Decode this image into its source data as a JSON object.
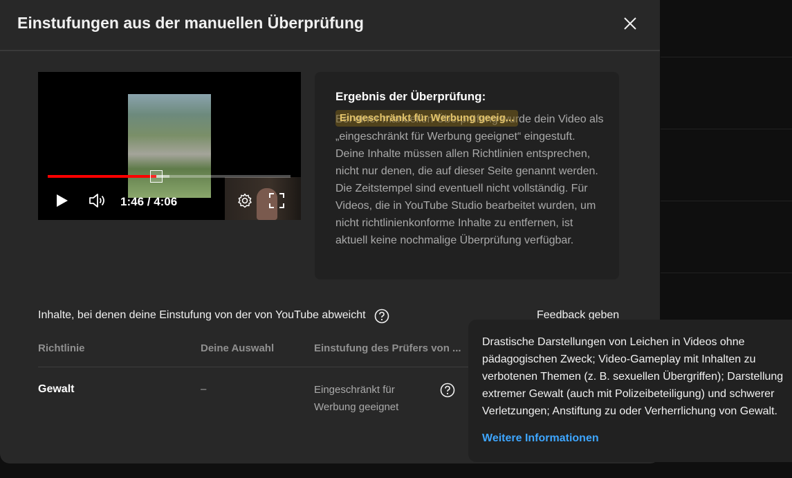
{
  "dialog": {
    "title": "Einstufungen aus der manuellen Überprüfung"
  },
  "player": {
    "time": "1:46 / 4:06",
    "progress": 0.446,
    "buffered": 0.5
  },
  "result": {
    "title": "Ergebnis der Überprüfung:",
    "badge": "Eingeschränkt für Werbung geeig...",
    "text": "Bei einer manuellen Überprüfung wurde dein Video als „eingeschränkt für Werbung geeignet“ eingestuft. Deine Inhalte müssen allen Richtlinien entsprechen, nicht nur denen, die auf dieser Seite genannt werden. Die Zeitstempel sind eventuell nicht vollständig. Für Videos, die in YouTube Studio bearbeitet wurden, um nicht richtlinienkonforme Inhalte zu entfernen, ist aktuell keine nochmalige Überprüfung verfügbar."
  },
  "section": {
    "label": "Inhalte, bei denen deine Einstufung von der von YouTube abweicht",
    "feedback": "Feedback geben"
  },
  "table": {
    "headers": [
      "Richtlinie",
      "Deine Auswahl",
      "Einstufung des Prüfers von ..."
    ],
    "rows": [
      {
        "policy": "Gewalt",
        "choice": "–",
        "rating": "Eingeschränkt für Werbung geeignet"
      }
    ]
  },
  "tooltip": {
    "text": "Drastische Darstellungen von Leichen in Videos ohne pädagogischen Zweck; Video-Gameplay mit Inhalten zu verbotenen Themen (z. B. sexuellen Übergriffen); Darstellung extremer Gewalt (auch mit Polizeibeteiligung) und schwerer Verletzungen; Anstiftung zu oder Verherrlichung von Gewalt.",
    "link": "Weitere Informationen"
  },
  "colors": {
    "dialog_bg": "#282828",
    "panel_bg": "#212121",
    "progress": "#ff0000",
    "link": "#3ea6ff",
    "badge_text": "#e2c36a"
  },
  "icons": [
    "close-icon",
    "play-icon",
    "volume-icon",
    "settings-icon",
    "fullscreen-icon",
    "help-icon"
  ]
}
